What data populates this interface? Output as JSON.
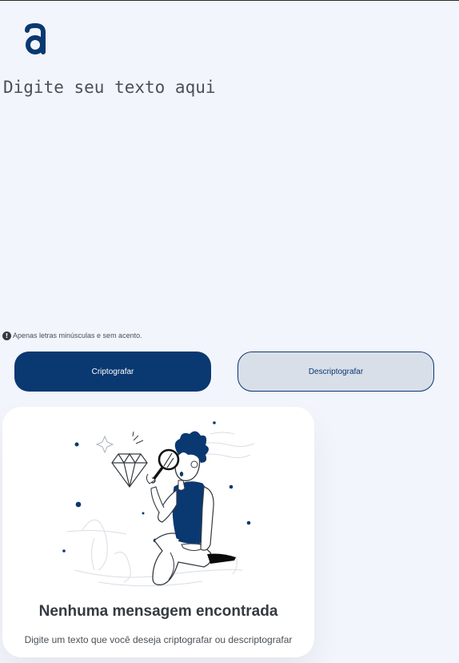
{
  "brand": {
    "logo_icon": "alura-logo-icon",
    "color": "#0A3871"
  },
  "editor": {
    "placeholder": "Digite seu texto aqui",
    "value": ""
  },
  "hint": {
    "icon": "exclamation-circle-icon",
    "text": "Apenas letras minúsculas e sem acento."
  },
  "actions": {
    "encrypt_label": "Criptografar",
    "decrypt_label": "Descriptografar"
  },
  "output": {
    "illustration": "person-with-magnifying-glass-illustration",
    "title": "Nenhuma mensagem encontrada",
    "subtitle": "Digite um texto que você deseja criptografar ou descriptografar"
  },
  "colors": {
    "background": "#F3F5FC",
    "primary": "#0A3871",
    "secondary": "#D8DFE8",
    "text": "#343a40"
  }
}
